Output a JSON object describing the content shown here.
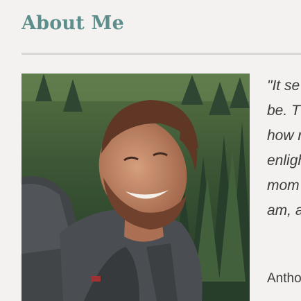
{
  "section": {
    "title": "About Me"
  },
  "photo": {
    "alt": "Smiling bearded man with a backpack in front of a pine forest"
  },
  "quote": {
    "lines": [
      "\"It se",
      "be. T",
      "how r",
      "enligh",
      "mom",
      "am, a"
    ]
  },
  "attribution": {
    "text": "Antho"
  },
  "colors": {
    "heading": "#5e8e8b",
    "background": "#f3f2f0",
    "rule": "#d9d8d6",
    "text": "#3b3b3b"
  }
}
